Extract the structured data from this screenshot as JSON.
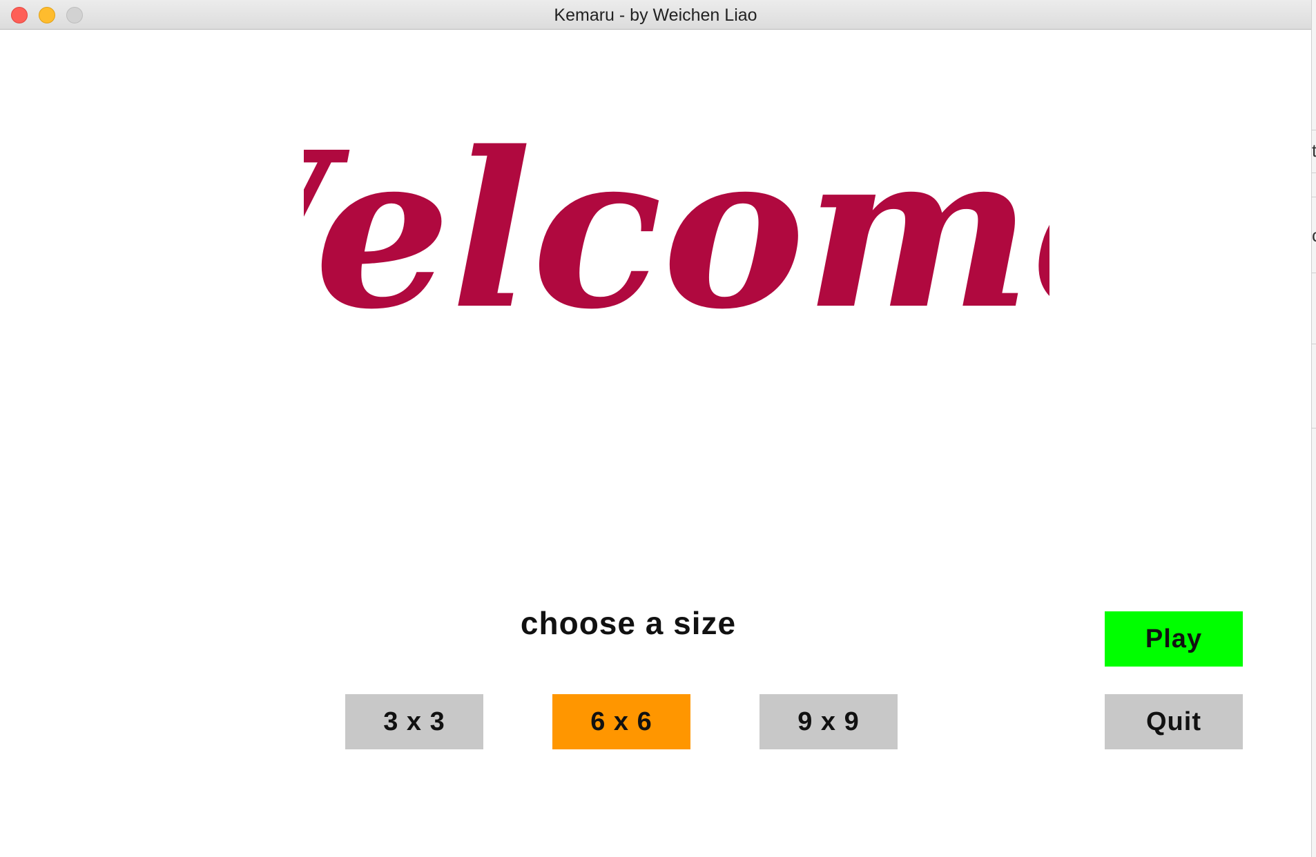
{
  "window": {
    "title": "Kemaru - by Weichen Liao"
  },
  "welcome": {
    "text": "Welcome!",
    "color": "#b0093f"
  },
  "size_chooser": {
    "label": "choose a size",
    "options": [
      {
        "label": "3 x 3",
        "color": "#c8c8c8",
        "selected": false
      },
      {
        "label": "6 x 6",
        "color": "#ff9600",
        "selected": true
      },
      {
        "label": "9 x 9",
        "color": "#c8c8c8",
        "selected": false
      }
    ]
  },
  "actions": {
    "play": {
      "label": "Play",
      "color": "#00ff00"
    },
    "quit": {
      "label": "Quit",
      "color": "#c8c8c8"
    }
  },
  "background_window": {
    "glyphs": [
      "t",
      "c"
    ]
  }
}
